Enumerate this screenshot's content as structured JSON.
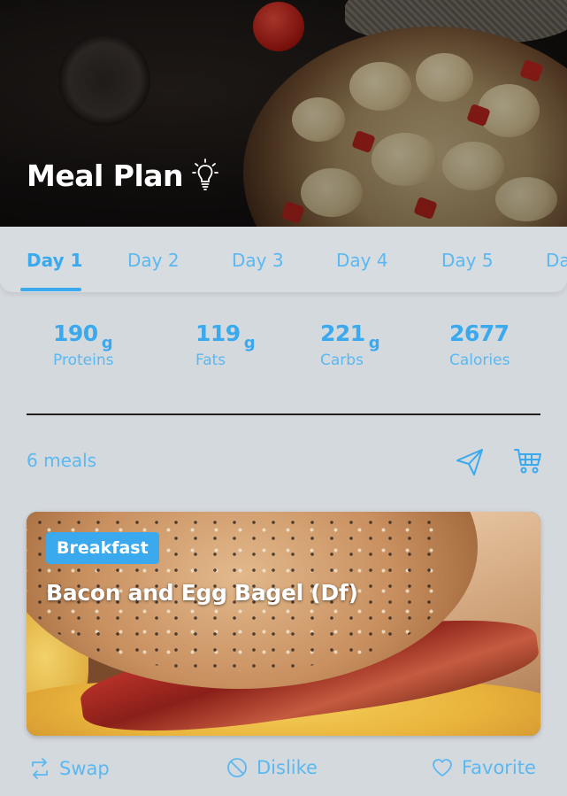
{
  "header": {
    "title": "Meal Plan",
    "icon": "lightbulb-icon"
  },
  "tabs": [
    {
      "label": "Day 1",
      "active": true
    },
    {
      "label": "Day 2",
      "active": false
    },
    {
      "label": "Day 3",
      "active": false
    },
    {
      "label": "Day 4",
      "active": false
    },
    {
      "label": "Day 5",
      "active": false
    },
    {
      "label": "Da",
      "active": false
    }
  ],
  "macros": [
    {
      "value": "190",
      "unit": "g",
      "label": "Proteins"
    },
    {
      "value": "119",
      "unit": "g",
      "label": "Fats"
    },
    {
      "value": "221",
      "unit": "g",
      "label": "Carbs"
    },
    {
      "value": "2677",
      "unit": "",
      "label": "Calories"
    }
  ],
  "meals": {
    "count_label": "6 meals",
    "share_icon": "paper-plane-icon",
    "cart_icon": "shopping-cart-icon"
  },
  "meal_card": {
    "badge": "Breakfast",
    "title": "Bacon and Egg Bagel (Df)"
  },
  "actions": {
    "swap": "Swap",
    "dislike": "Dislike",
    "favorite": "Favorite"
  },
  "colors": {
    "accent": "#3aa9ee",
    "background": "#d4d9de",
    "divider": "#1f1f1f"
  }
}
